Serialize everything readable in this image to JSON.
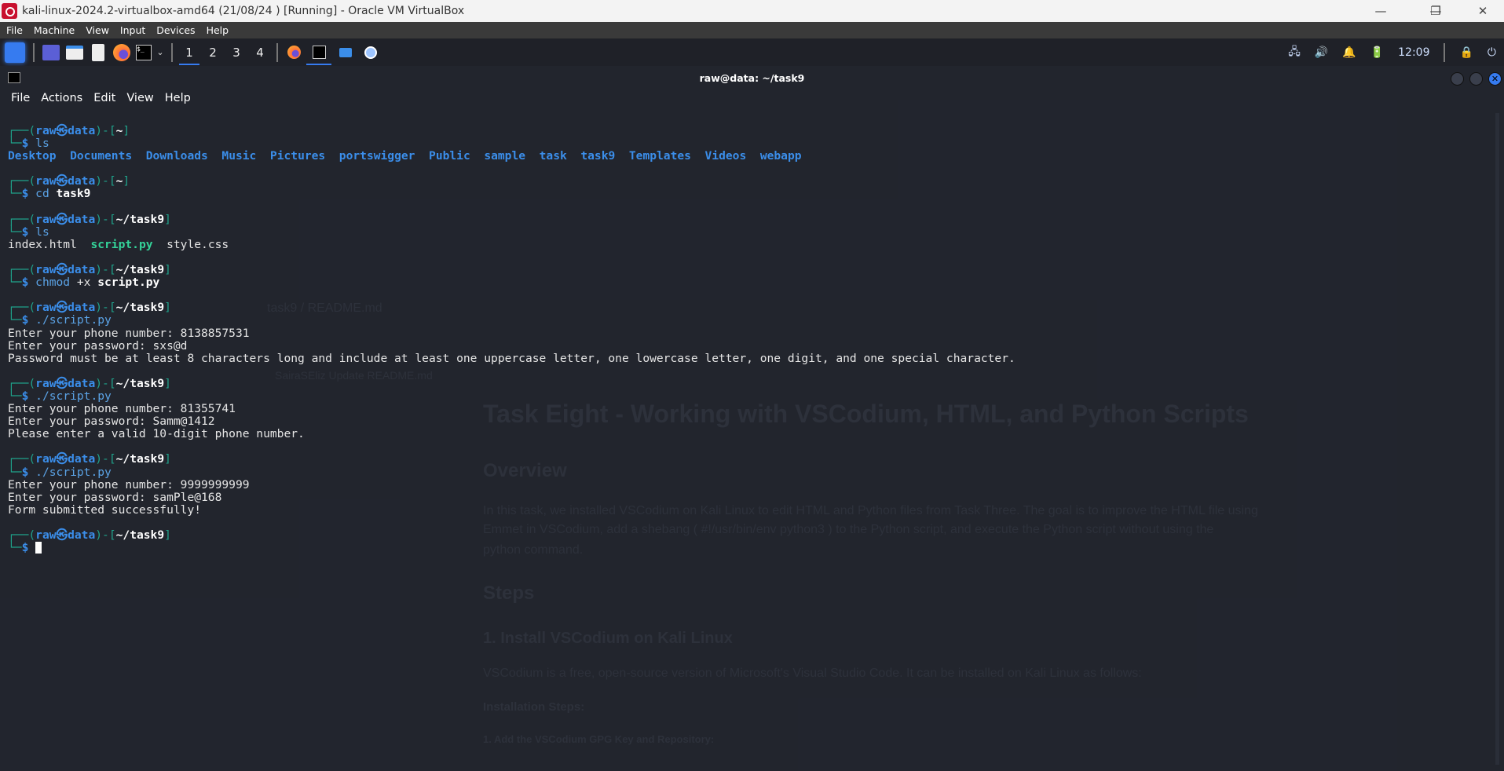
{
  "window": {
    "title": "kali-linux-2024.2-virtualbox-amd64 (21/08/24 ) [Running] - Oracle VM VirtualBox",
    "minimize": "—",
    "restore": "❐",
    "close": "✕"
  },
  "vbox_menu": [
    "File",
    "Machine",
    "View",
    "Input",
    "Devices",
    "Help"
  ],
  "panel": {
    "workspaces": [
      "1",
      "2",
      "3",
      "4"
    ],
    "active_workspace": "1",
    "clock": "12:09"
  },
  "terminal": {
    "title": "raw@data: ~/task9",
    "menu": [
      "File",
      "Actions",
      "Edit",
      "View",
      "Help"
    ],
    "lines": [
      [
        [
          "┌──(",
          "teal"
        ],
        [
          "raw㉿data",
          "blue"
        ],
        [
          ")-[",
          "teal"
        ],
        [
          "~",
          "wb"
        ],
        [
          "]",
          "teal"
        ]
      ],
      [
        [
          "└─",
          "teal"
        ],
        [
          "$",
          "blue"
        ],
        [
          " ls",
          "cmd"
        ]
      ],
      [
        [
          "Desktop",
          "dir"
        ],
        [
          "  ",
          "n"
        ],
        [
          "Documents",
          "dir"
        ],
        [
          "  ",
          "n"
        ],
        [
          "Downloads",
          "dir"
        ],
        [
          "  ",
          "n"
        ],
        [
          "Music",
          "dir"
        ],
        [
          "  ",
          "n"
        ],
        [
          "Pictures",
          "dir"
        ],
        [
          "  ",
          "n"
        ],
        [
          "portswigger",
          "dir"
        ],
        [
          "  ",
          "n"
        ],
        [
          "Public",
          "dir"
        ],
        [
          "  ",
          "n"
        ],
        [
          "sample",
          "dir"
        ],
        [
          "  ",
          "n"
        ],
        [
          "task",
          "dir"
        ],
        [
          "  ",
          "n"
        ],
        [
          "task9",
          "dir"
        ],
        [
          "  ",
          "n"
        ],
        [
          "Templates",
          "dir"
        ],
        [
          "  ",
          "n"
        ],
        [
          "Videos",
          "dir"
        ],
        [
          "  ",
          "n"
        ],
        [
          "webapp",
          "dir"
        ]
      ],
      [],
      [
        [
          "┌──(",
          "teal"
        ],
        [
          "raw㉿data",
          "blue"
        ],
        [
          ")-[",
          "teal"
        ],
        [
          "~",
          "wb"
        ],
        [
          "]",
          "teal"
        ]
      ],
      [
        [
          "└─",
          "teal"
        ],
        [
          "$",
          "blue"
        ],
        [
          " cd",
          "cmd"
        ],
        [
          " task9",
          "arg"
        ]
      ],
      [],
      [
        [
          "┌──(",
          "teal"
        ],
        [
          "raw㉿data",
          "blue"
        ],
        [
          ")-[",
          "teal"
        ],
        [
          "~/task9",
          "wb"
        ],
        [
          "]",
          "teal"
        ]
      ],
      [
        [
          "└─",
          "teal"
        ],
        [
          "$",
          "blue"
        ],
        [
          " ls",
          "cmd"
        ]
      ],
      [
        [
          "index.html",
          "n"
        ],
        [
          "  ",
          "n"
        ],
        [
          "script.py",
          "exe"
        ],
        [
          "  ",
          "n"
        ],
        [
          "style.css",
          "n"
        ]
      ],
      [],
      [
        [
          "┌──(",
          "teal"
        ],
        [
          "raw㉿data",
          "blue"
        ],
        [
          ")-[",
          "teal"
        ],
        [
          "~/task9",
          "wb"
        ],
        [
          "]",
          "teal"
        ]
      ],
      [
        [
          "└─",
          "teal"
        ],
        [
          "$",
          "blue"
        ],
        [
          " chmod",
          "cmd"
        ],
        [
          " +x",
          "opt"
        ],
        [
          " script.py",
          "arg"
        ]
      ],
      [],
      [
        [
          "┌──(",
          "teal"
        ],
        [
          "raw㉿data",
          "blue"
        ],
        [
          ")-[",
          "teal"
        ],
        [
          "~/task9",
          "wb"
        ],
        [
          "]",
          "teal"
        ]
      ],
      [
        [
          "└─",
          "teal"
        ],
        [
          "$",
          "blue"
        ],
        [
          " ./script.py",
          "cmd"
        ]
      ],
      [
        [
          "Enter your phone number: 8138857531",
          "n"
        ]
      ],
      [
        [
          "Enter your password: sxs@d",
          "n"
        ]
      ],
      [
        [
          "Password must be at least 8 characters long and include at least one uppercase letter, one lowercase letter, one digit, and one special character.",
          "n"
        ]
      ],
      [],
      [
        [
          "┌──(",
          "teal"
        ],
        [
          "raw㉿data",
          "blue"
        ],
        [
          ")-[",
          "teal"
        ],
        [
          "~/task9",
          "wb"
        ],
        [
          "]",
          "teal"
        ]
      ],
      [
        [
          "└─",
          "teal"
        ],
        [
          "$",
          "blue"
        ],
        [
          " ./script.py",
          "cmd"
        ]
      ],
      [
        [
          "Enter your phone number: 81355741",
          "n"
        ]
      ],
      [
        [
          "Enter your password: Samm@1412",
          "n"
        ]
      ],
      [
        [
          "Please enter a valid 10-digit phone number.",
          "n"
        ]
      ],
      [],
      [
        [
          "┌──(",
          "teal"
        ],
        [
          "raw㉿data",
          "blue"
        ],
        [
          ")-[",
          "teal"
        ],
        [
          "~/task9",
          "wb"
        ],
        [
          "]",
          "teal"
        ]
      ],
      [
        [
          "└─",
          "teal"
        ],
        [
          "$",
          "blue"
        ],
        [
          " ./script.py",
          "cmd"
        ]
      ],
      [
        [
          "Enter your phone number: 9999999999",
          "n"
        ]
      ],
      [
        [
          "Enter your password: samPle@168",
          "n"
        ]
      ],
      [
        [
          "Form submitted successfully!",
          "n"
        ]
      ],
      [],
      [
        [
          "┌──(",
          "teal"
        ],
        [
          "raw㉿data",
          "blue"
        ],
        [
          ")-[",
          "teal"
        ],
        [
          "~/task9",
          "wb"
        ],
        [
          "]",
          "teal"
        ]
      ],
      [
        [
          "└─",
          "teal"
        ],
        [
          "$",
          "blue"
        ],
        [
          " ",
          "n"
        ]
      ]
    ]
  },
  "background_readme": {
    "heading": "Task Eight - Working with VSCodium, HTML, and Python Scripts",
    "overview": "Overview",
    "para1": "In this task, we installed VSCodium on Kali Linux to edit HTML and Python files from Task Three. The goal is to improve the HTML file using",
    "para2": "Emmet in VSCodium, add a shebang ( #!/usr/bin/env python3 ) to the Python script, and execute the Python script without using the",
    "para3": "python  command.",
    "steps": "Steps",
    "step1": "1. Install VSCodium on Kali Linux",
    "step1_text": "VSCodium is a free, open-source version of Microsoft's Visual Studio Code. It can be installed on Kali Linux as follows:",
    "install": "Installation Steps:",
    "substep": "1. Add the VSCodium GPG Key and Repository:",
    "file_title": "task9 / README.md",
    "commit": "SairaSEliz  Update README.md"
  },
  "colors": {
    "accent": "#367bf0",
    "prompt": "#1fa38b",
    "user": "#3b8eea",
    "executable": "#34d399"
  }
}
